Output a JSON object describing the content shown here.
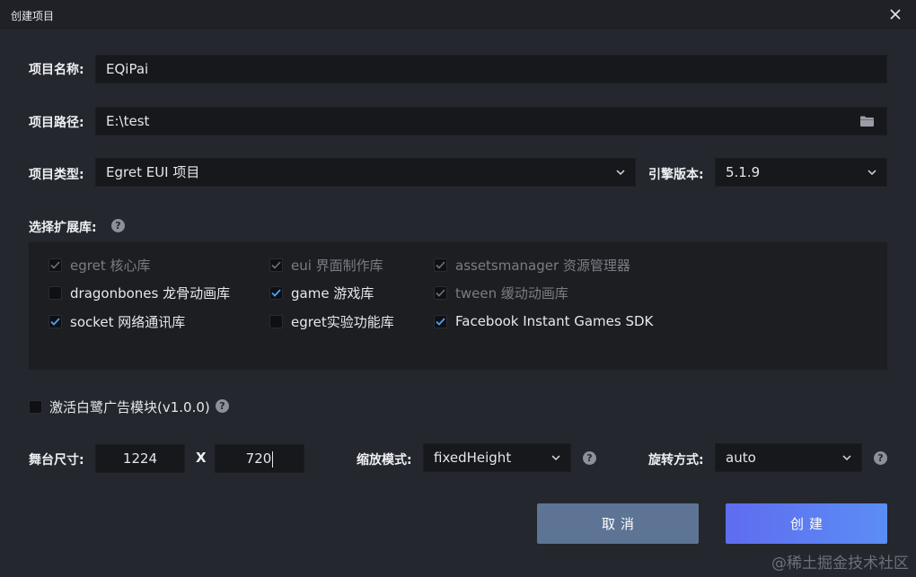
{
  "window": {
    "title": "创建项目"
  },
  "project_name": {
    "label": "项目名称:",
    "value": "EQiPai"
  },
  "project_path": {
    "label": "项目路径:",
    "value": "E:\\test"
  },
  "project_type": {
    "label": "项目类型:",
    "value": "Egret EUI 项目"
  },
  "engine_version": {
    "label": "引擎版本:",
    "value": "5.1.9"
  },
  "extensions": {
    "label": "选择扩展库:",
    "items": [
      {
        "label": "egret 核心库",
        "checked": true,
        "disabled": true
      },
      {
        "label": "eui 界面制作库",
        "checked": true,
        "disabled": true
      },
      {
        "label": "assetsmanager 资源管理器",
        "checked": true,
        "disabled": true
      },
      {
        "label": "dragonbones 龙骨动画库",
        "checked": false,
        "disabled": false
      },
      {
        "label": "game 游戏库",
        "checked": true,
        "disabled": false
      },
      {
        "label": "tween 缓动动画库",
        "checked": true,
        "disabled": true
      },
      {
        "label": "socket 网络通讯库",
        "checked": true,
        "disabled": false
      },
      {
        "label": "egret实验功能库",
        "checked": false,
        "disabled": false
      },
      {
        "label": "Facebook Instant Games SDK",
        "checked": true,
        "disabled": false
      }
    ]
  },
  "ad_module": {
    "label": "激活白鹭广告模块(v1.0.0)",
    "checked": false
  },
  "stage_size": {
    "label": "舞台尺寸:",
    "width": "1224",
    "separator": "X",
    "height": "720"
  },
  "scale_mode": {
    "label": "缩放模式:",
    "value": "fixedHeight"
  },
  "orientation": {
    "label": "旋转方式:",
    "value": "auto"
  },
  "buttons": {
    "cancel": "取消",
    "create": "创建"
  },
  "help_glyph": "?",
  "watermark": "@稀土掘金技术社区",
  "icons": {
    "close": "close-icon",
    "folder": "folder-icon",
    "chevron": "chevron-down-icon",
    "help": "help-icon",
    "check": "check-icon"
  },
  "colors": {
    "accent_check": "#4aa3ff",
    "create_button_start": "#5f6cf0",
    "create_button_end": "#5b8df4",
    "cancel_button": "#5d7494"
  }
}
